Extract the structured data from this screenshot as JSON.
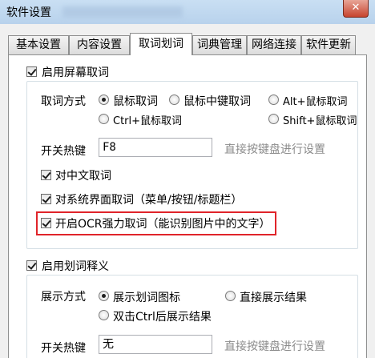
{
  "window": {
    "title": "软件设置",
    "close_glyph": "✕"
  },
  "tabs": [
    {
      "label": "基本设置"
    },
    {
      "label": "内容设置"
    },
    {
      "label": "取词划词"
    },
    {
      "label": "词典管理"
    },
    {
      "label": "网络连接"
    },
    {
      "label": "软件更新"
    }
  ],
  "screen_capture": {
    "enable_label": "启用屏幕取词",
    "mode_label": "取词方式",
    "modes": [
      {
        "label": "鼠标取词",
        "selected": true
      },
      {
        "label": "鼠标中键取词",
        "selected": false
      },
      {
        "label": "Alt+鼠标取词",
        "selected": false
      },
      {
        "label": "Ctrl+鼠标取词",
        "selected": false
      },
      {
        "label": "Shift+鼠标取词",
        "selected": false
      }
    ],
    "hotkey_label": "开关热键",
    "hotkey_value": "F8",
    "hotkey_hint": "直接按键盘进行设置",
    "chinese_label": "对中文取词",
    "system_ui_label": "对系统界面取词（菜单/按钮/标题栏）",
    "ocr_label": "开启OCR强力取词（能识别图片中的文字）"
  },
  "selection": {
    "enable_label": "启用划词释义",
    "mode_label": "展示方式",
    "modes": [
      {
        "label": "展示划词图标",
        "selected": true
      },
      {
        "label": "直接展示结果",
        "selected": false
      },
      {
        "label": "双击Ctrl后展示结果",
        "selected": false
      }
    ],
    "hotkey_label": "开关热键",
    "hotkey_value": "无",
    "hotkey_hint": "直接按键盘进行设置"
  },
  "colors": {
    "highlight": "#e0242a",
    "titlebar": "#b8d2ec",
    "hint": "#8c8c8c"
  }
}
